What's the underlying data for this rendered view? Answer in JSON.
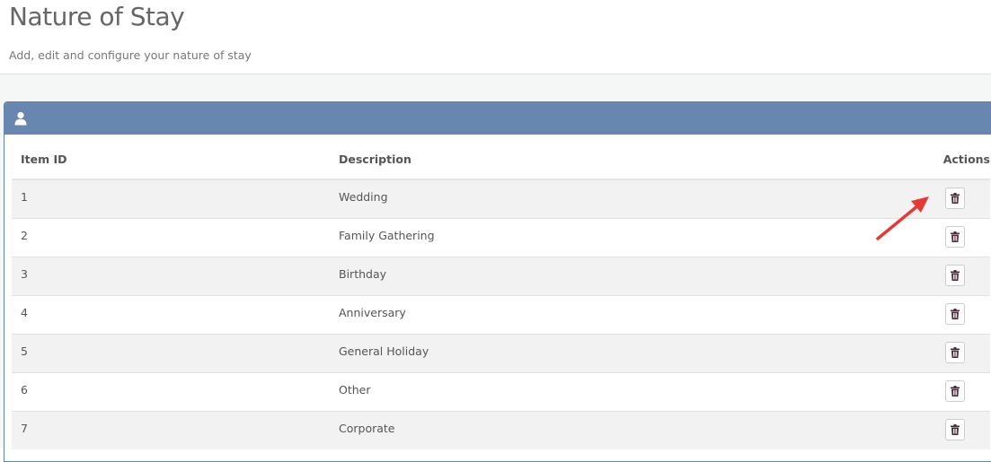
{
  "header": {
    "title": "Nature of Stay",
    "subtitle": "Add, edit and configure your nature of stay"
  },
  "panel": {
    "icon": "user-icon"
  },
  "table": {
    "columns": {
      "id": "Item ID",
      "description": "Description",
      "actions": "Actions"
    },
    "rows": [
      {
        "id": "1",
        "description": "Wedding",
        "action_icon": "trash-icon"
      },
      {
        "id": "2",
        "description": "Family Gathering",
        "action_icon": "trash-icon"
      },
      {
        "id": "3",
        "description": "Birthday",
        "action_icon": "trash-icon"
      },
      {
        "id": "4",
        "description": "Anniversary",
        "action_icon": "trash-icon"
      },
      {
        "id": "5",
        "description": "General Holiday",
        "action_icon": "trash-icon"
      },
      {
        "id": "6",
        "description": "Other",
        "action_icon": "trash-icon"
      },
      {
        "id": "7",
        "description": "Corporate",
        "action_icon": "trash-icon"
      }
    ]
  },
  "colors": {
    "panel_header": "#6786b0",
    "annotation_arrow": "#e53935",
    "trash_icon": "#4a2a3a"
  }
}
